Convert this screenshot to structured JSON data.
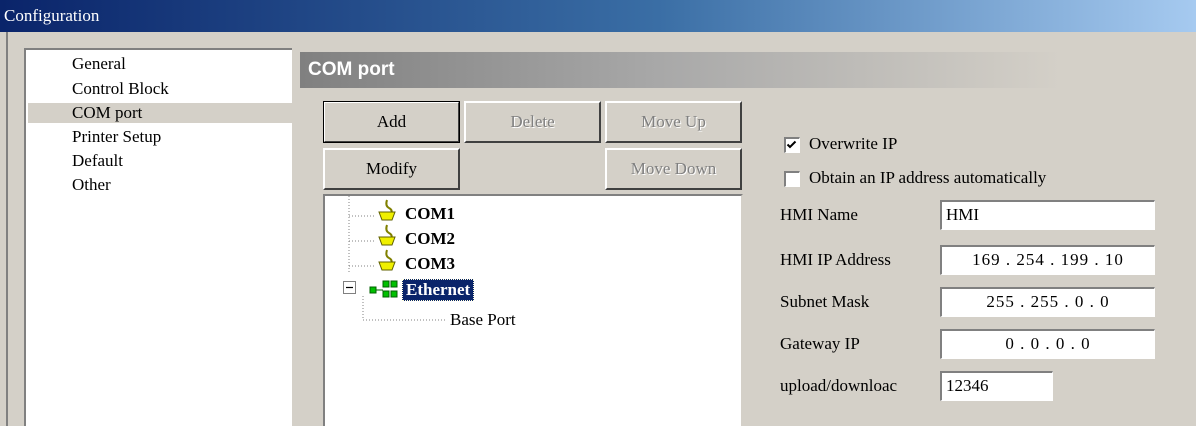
{
  "window": {
    "title": "Configuration"
  },
  "nav": {
    "items": [
      {
        "label": "General"
      },
      {
        "label": "Control Block"
      },
      {
        "label": "COM port"
      },
      {
        "label": "Printer Setup"
      },
      {
        "label": "Default"
      },
      {
        "label": "Other"
      }
    ],
    "selected": "COM port"
  },
  "section": {
    "title": "COM port"
  },
  "buttons": {
    "add": "Add",
    "delete": "Delete",
    "move_up": "Move Up",
    "modify": "Modify",
    "move_down": "Move Down"
  },
  "tree": {
    "nodes": [
      {
        "label": "COM1",
        "icon": "serial-port-icon"
      },
      {
        "label": "COM2",
        "icon": "serial-port-icon"
      },
      {
        "label": "COM3",
        "icon": "serial-port-icon"
      },
      {
        "label": "Ethernet",
        "icon": "network-icon",
        "expanded": true,
        "selected": true
      }
    ],
    "ethernet_child": "Base Port"
  },
  "settings": {
    "overwrite_ip": {
      "label": "Overwrite IP",
      "checked": true
    },
    "obtain_auto": {
      "label": "Obtain an IP address automatically",
      "checked": false
    },
    "hmi_name": {
      "label": "HMI Name",
      "value": "HMI"
    },
    "hmi_ip": {
      "label": "HMI IP Address",
      "value": "169 . 254 . 199 . 10"
    },
    "subnet": {
      "label": "Subnet Mask",
      "value": "255 . 255 .  0  .  0"
    },
    "gateway": {
      "label": "Gateway IP",
      "value": "0  .  0  .  0  .  0"
    },
    "upload_port": {
      "label": "upload/downloac",
      "value": "12346"
    }
  },
  "colors": {
    "title_start": "#0a246a",
    "title_end": "#a6caf0",
    "selection": "#0a246a",
    "face": "#d4d0c8"
  }
}
